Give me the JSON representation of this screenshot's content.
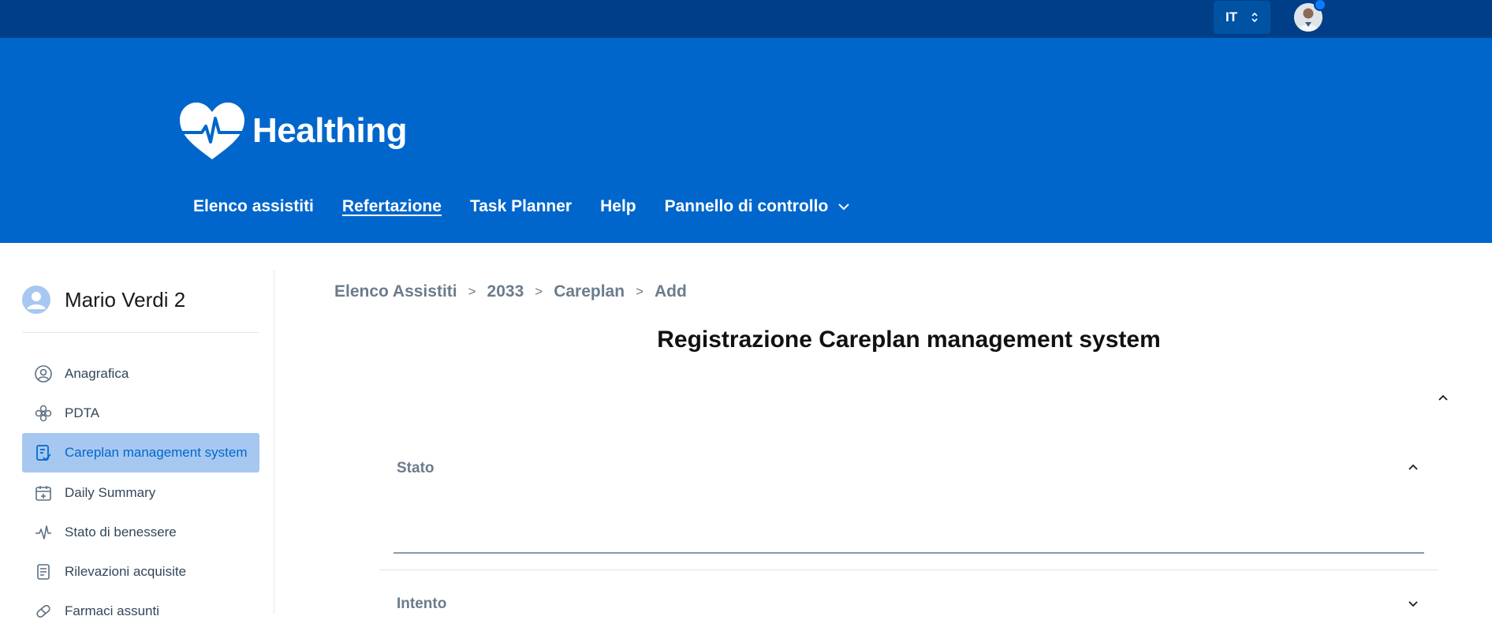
{
  "topbar": {
    "language": "IT",
    "language_icon": "updown-chevron-icon",
    "avatar_icon": "user-avatar-icon"
  },
  "header": {
    "brand": "Healthing",
    "logo_icon": "heart-pulse-icon",
    "nav": [
      {
        "label": "Elenco assistiti"
      },
      {
        "label": "Refertazione",
        "active": true
      },
      {
        "label": "Task Planner"
      },
      {
        "label": "Help"
      },
      {
        "label": "Pannello di controllo",
        "icon": "chevron-down-icon"
      }
    ]
  },
  "sidebar": {
    "user_name": "Mario Verdi 2",
    "items": [
      {
        "label": "Anagrafica",
        "icon": "user-circle-icon"
      },
      {
        "label": "PDTA",
        "icon": "flower-icon"
      },
      {
        "label": "Careplan management system",
        "icon": "clipboard-check-icon",
        "active": true
      },
      {
        "label": "Daily Summary",
        "icon": "calendar-plus-icon"
      },
      {
        "label": "Stato di benessere",
        "icon": "pulse-icon"
      },
      {
        "label": "Rilevazioni acquisite",
        "icon": "document-list-icon"
      },
      {
        "label": "Farmaci assunti",
        "icon": "pill-icon"
      }
    ]
  },
  "breadcrumb": [
    "Elenco Assistiti",
    "2033",
    "Careplan",
    "Add"
  ],
  "breadcrumb_separator": ">",
  "main": {
    "title": "Registrazione Careplan management system",
    "fields": [
      {
        "label": "Stato",
        "expanded": true
      },
      {
        "label": "Intento",
        "expanded": false
      }
    ]
  },
  "colors": {
    "topbar": "#003f87",
    "header": "#0066cc",
    "active_item_bg": "#a6c8f0",
    "active_item_text": "#0066cc"
  }
}
